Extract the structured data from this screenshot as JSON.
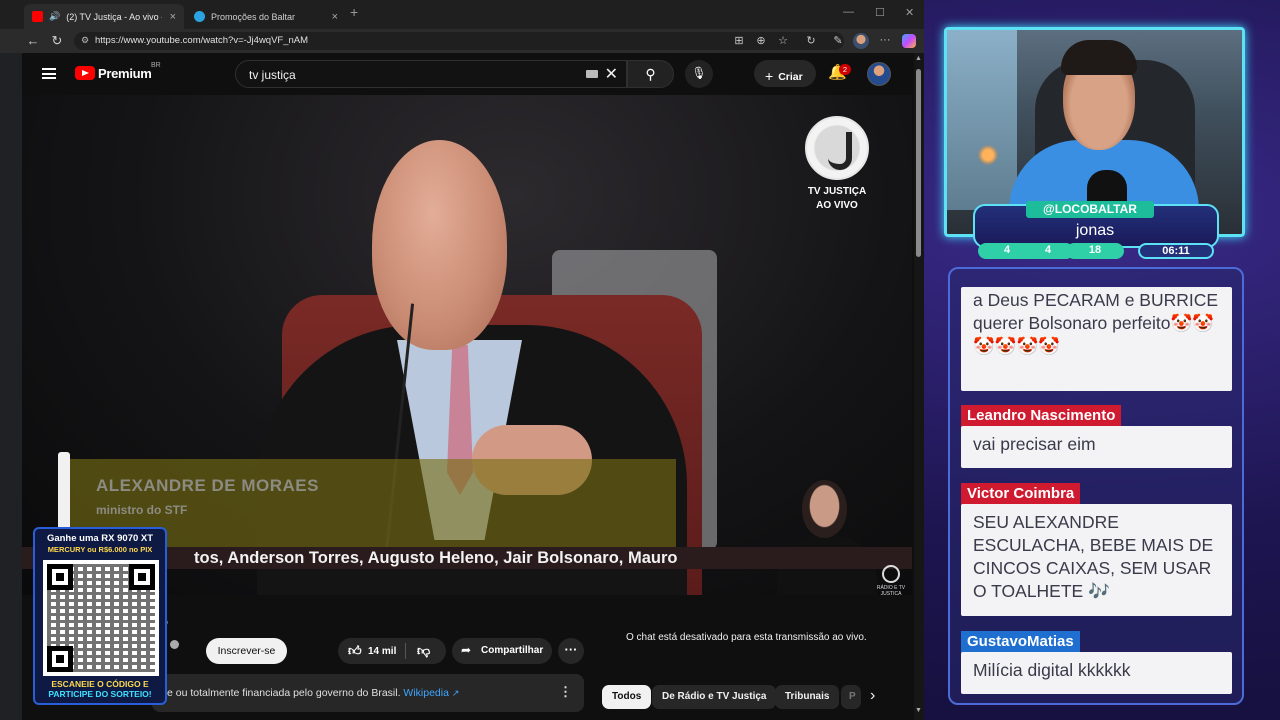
{
  "browser": {
    "tabs": [
      {
        "title": "(2) TV Justiça - Ao vivo - YouTube",
        "active": true,
        "icon": "youtube-icon"
      },
      {
        "title": "Promoções do Baltar",
        "active": false,
        "icon": "telegram-icon"
      }
    ],
    "new_tab": "+",
    "url": "https://www.youtube.com/watch?v=-Jj4wqVF_nAM"
  },
  "youtube": {
    "brand": "Premium",
    "country": "BR",
    "search_value": "tv justiça",
    "create_label": "Criar",
    "notification_count": "2",
    "player": {
      "logo_text": "TV JUSTIÇA",
      "logo_sub": "AO VIVO",
      "lower_third_name": "ALEXANDRE DE MORAES",
      "lower_third_role": "ministro do STF",
      "ticker": "tos, Anderson Torres, Augusto Heleno, Jair Bolsonaro, Mauro",
      "corner_bug": "RÁDIO E TV JUSTIÇA"
    },
    "below": {
      "title_fragment": "o",
      "channel_fragment": "a",
      "subscribe_label": "Inscrever-se",
      "likes": "14 mil",
      "share_label": "Compartilhar",
      "chat_disabled": "O chat está desativado para esta transmissão ao vivo.",
      "description": "e ou totalmente financiada pelo governo do Brasil.",
      "wiki_link": "Wikipedia",
      "chips": [
        "Todos",
        "De Rádio e TV Justiça",
        "Tribunais",
        "P"
      ]
    }
  },
  "promo": {
    "line1": "Ganhe uma RX 9070 XT",
    "line2": "MERCURY ou R$6.000 no PIX",
    "cta1": "ESCANEIE O CÓDIGO E",
    "cta2": "PARTICIPE DO SORTEIO!"
  },
  "stream_overlay": {
    "handle": "@LOCOBALTAR",
    "name": "jonas",
    "stats": [
      "4",
      "4",
      "18",
      "06:11"
    ],
    "accent": "#5ce1f5"
  },
  "chat": {
    "messages": [
      {
        "author": "",
        "text": "a Deus PECARAM e BURRICE querer Bolsonaro perfeito🤡🤡🤡🤡🤡🤡"
      },
      {
        "author": "Leandro Nascimento",
        "text": "vai precisar eim"
      },
      {
        "author": "Victor Coimbra",
        "text": "SEU ALEXANDRE ESCULACHA, BEBE MAIS DE CINCOS CAIXAS, SEM USAR O TOALHETE 🎶"
      },
      {
        "author": "GustavoMatias",
        "text": "Milícia digital kkkkkk"
      }
    ]
  }
}
